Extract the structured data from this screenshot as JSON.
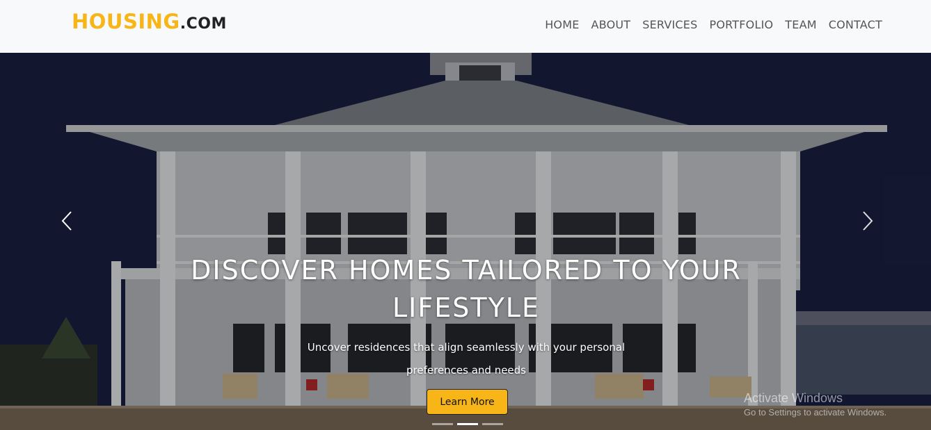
{
  "brand": {
    "name": "HOUSING",
    "suffix": ".COM"
  },
  "nav": {
    "items": [
      {
        "label": "HOME"
      },
      {
        "label": "ABOUT"
      },
      {
        "label": "SERVICES"
      },
      {
        "label": "PORTFOLIO"
      },
      {
        "label": "TEAM"
      },
      {
        "label": "CONTACT"
      }
    ]
  },
  "hero": {
    "title": "DISCOVER HOMES TAILORED TO YOUR LIFESTYLE",
    "subtitle": "Uncover residences that align seamlessly with your personal preferences and needs",
    "cta_label": "Learn More",
    "prev_icon": "chevron-left-icon",
    "next_icon": "chevron-right-icon",
    "slide_count": 3,
    "active_slide": 2
  },
  "watermark": {
    "title": "Activate Windows",
    "subtitle": "Go to Settings to activate Windows."
  },
  "colors": {
    "accent": "#f8b518",
    "navbar_bg": "#f8f9fa",
    "nav_text": "#555555"
  }
}
